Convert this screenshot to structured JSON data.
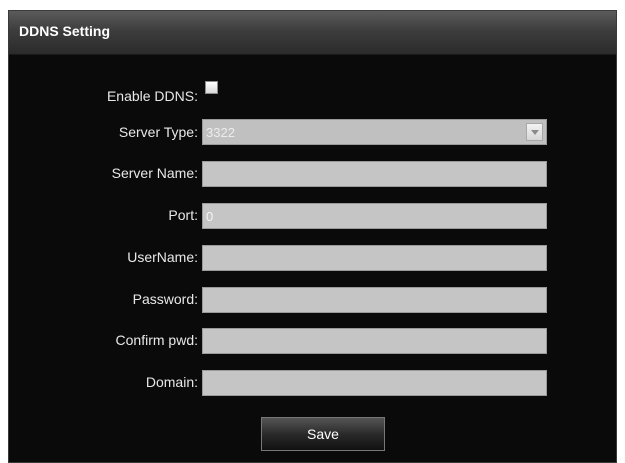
{
  "window": {
    "title": "DDNS Setting"
  },
  "form": {
    "enable_ddns_label": "Enable DDNS:",
    "enable_ddns_checked": false,
    "server_type_label": "Server Type:",
    "server_type_value": "3322",
    "server_name_label": "Server Name:",
    "server_name_value": "",
    "port_label": "Port:",
    "port_value": "0",
    "username_label": "UserName:",
    "username_value": "",
    "password_label": "Password:",
    "password_value": "",
    "confirm_pwd_label": "Confirm pwd:",
    "confirm_pwd_value": "",
    "domain_label": "Domain:",
    "domain_value": ""
  },
  "actions": {
    "save_label": "Save"
  },
  "icons": {
    "dropdown": "chevron-down-icon"
  },
  "colors": {
    "panel_bg": "#0a0a0a",
    "field_bg": "#c5c5c5",
    "label_text": "#e8e8e8"
  }
}
